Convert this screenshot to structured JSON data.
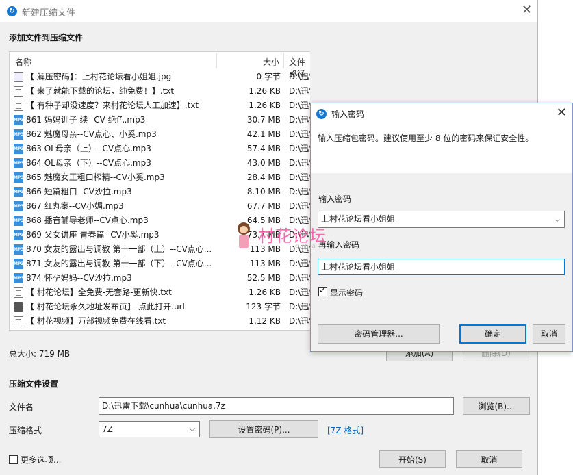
{
  "window": {
    "title": "新建压缩文件"
  },
  "add_section": {
    "label": "添加文件到压缩文件"
  },
  "columns": {
    "name": "名称",
    "size": "大小",
    "path": "文件路径"
  },
  "files": [
    {
      "icon": "jpg",
      "name": "【 解压密码】：上村花论坛看小姐姐.jpg",
      "size": "0 字节",
      "path": "D:\\迅雷下载\\cunhua\\【 解压密码】：上村花论坛"
    },
    {
      "icon": "txt",
      "name": "【 来了就能下载的论坛，纯免费！】.txt",
      "size": "1.26 KB",
      "path": "D:\\迅雷下载\\cunhua\\【 来了就能下载的论坛，纯免"
    },
    {
      "icon": "txt",
      "name": "【 有种子却没速度？来村花论坛人工加速】.txt",
      "size": "1.26 KB",
      "path": "D:\\迅雷下载\\cunhua\\【 有种子却没速度？来村花"
    },
    {
      "icon": "mp3",
      "name": "861 妈妈训子 续--CV 绝色.mp3",
      "size": "30.7 MB",
      "path": "D:\\迅雷"
    },
    {
      "icon": "mp3",
      "name": "862 魅魔母亲--CV点心、小奚.mp3",
      "size": "42.1 MB",
      "path": "D:\\迅雷"
    },
    {
      "icon": "mp3",
      "name": "863 OL母亲（上）--CV点心.mp3",
      "size": "57.4 MB",
      "path": "D:\\迅雷"
    },
    {
      "icon": "mp3",
      "name": "864 OL母亲（下）--CV点心.mp3",
      "size": "43.0 MB",
      "path": "D:\\迅雷"
    },
    {
      "icon": "mp3",
      "name": "865 魅魔女王粗口榨精--CV小奚.mp3",
      "size": "28.4 MB",
      "path": "D:\\迅雷"
    },
    {
      "icon": "mp3",
      "name": "866 短篇粗口--CV沙拉.mp3",
      "size": "8.10 MB",
      "path": "D:\\迅雷"
    },
    {
      "icon": "mp3",
      "name": "867 红丸案--CV小媚.mp3",
      "size": "67.7 MB",
      "path": "D:\\迅雷"
    },
    {
      "icon": "mp3",
      "name": "868 播音辅导老师--CV点心.mp3",
      "size": "64.5 MB",
      "path": "D:\\迅雷"
    },
    {
      "icon": "mp3",
      "name": "869 父女讲座 青春篇--CV小奚.mp3",
      "size": "73.7 MB",
      "path": "D:\\迅雷"
    },
    {
      "icon": "mp3",
      "name": "870 女友的露出与调教 第十一部（上）--CV点心...",
      "size": "113 MB",
      "path": "D:\\迅雷"
    },
    {
      "icon": "mp3",
      "name": "871 女友的露出与调教 第十一部（下）--CV点心...",
      "size": "113 MB",
      "path": "D:\\迅雷"
    },
    {
      "icon": "mp3",
      "name": "874 怀孕妈妈--CV沙拉.mp3",
      "size": "52.5 MB",
      "path": "D:\\迅雷"
    },
    {
      "icon": "txt",
      "name": "【 村花论坛】全免费-无套路-更新快.txt",
      "size": "1.26 KB",
      "path": "D:\\迅雷"
    },
    {
      "icon": "url",
      "name": "【 村花论坛永久地址发布页】-点此打开.url",
      "size": "123 字节",
      "path": "D:\\迅雷"
    },
    {
      "icon": "txt",
      "name": "【 村花视频】万部视频免费在线看.txt",
      "size": "1.12 KB",
      "path": "D:\\迅雷"
    }
  ],
  "total_size": "总大小: 719 MB",
  "add_button": "添加(A)",
  "delete_button": "删除(D)",
  "settings_section": {
    "label": "压缩文件设置"
  },
  "filename": {
    "label": "文件名",
    "value": "D:\\迅雷下载\\cunhua\\cunhua.7z",
    "browse": "浏览(B)..."
  },
  "format": {
    "label": "压缩格式",
    "value": "7Z",
    "set_password": "设置密码(P)...",
    "format_link": "[7Z 格式]"
  },
  "more_options": "更多选项...",
  "start_button": "开始(S)",
  "cancel_button": "取消",
  "password_dialog": {
    "title": "输入密码",
    "description": "输入压缩包密码。建议使用至少 8 位的密码来保证安全性。",
    "password_label": "输入密码",
    "password_value": "上村花论坛看小姐姐",
    "reenter_label": "再输入密码",
    "reenter_value": "上村花论坛看小姐姐",
    "show_password": "显示密码",
    "show_password_checked": true,
    "manager_button": "密码管理器...",
    "ok_button": "确定",
    "cancel_button": "取消"
  },
  "watermark": {
    "text": "村花论坛",
    "sub": "cunhua"
  }
}
